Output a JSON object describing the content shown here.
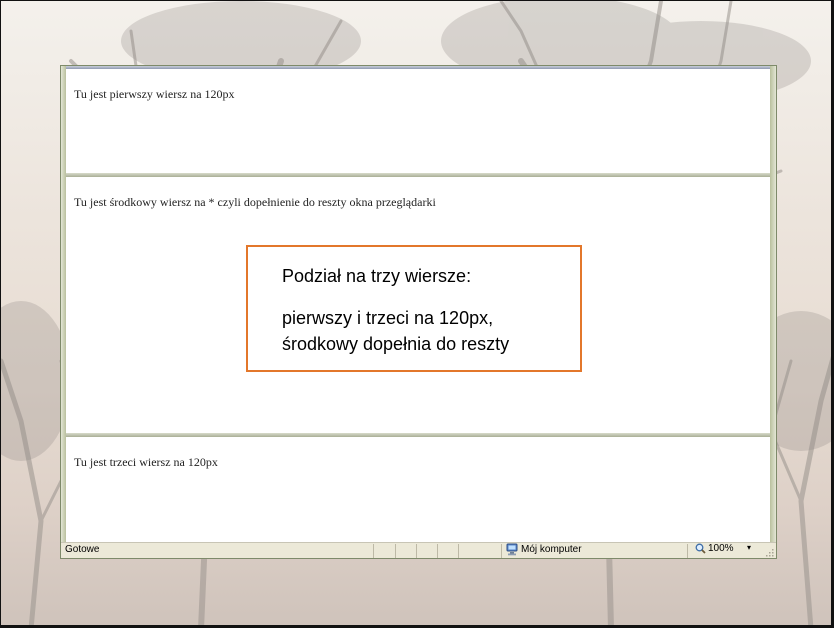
{
  "colors": {
    "callout_border": "#e3772b",
    "window_frame": "#7e8a6a",
    "statusbar_bg": "#ece9d8"
  },
  "frames": {
    "top": "Tu jest pierwszy wiersz na 120px",
    "middle": "Tu jest środkowy wiersz na * czyli dopełnienie do reszty okna przeglądarki",
    "bottom": "Tu jest trzeci wiersz na 120px"
  },
  "statusbar": {
    "status": "Gotowe",
    "zone_icon": "computer-icon",
    "zone": "Mój komputer",
    "zoom_icon": "magnifier-icon",
    "zoom": "100%",
    "zoom_dropdown": "▾"
  },
  "callout": {
    "title": "Podział na trzy wiersze:",
    "line1": "pierwszy i trzeci na 120px,",
    "line2": "środkowy dopełnia do reszty"
  }
}
